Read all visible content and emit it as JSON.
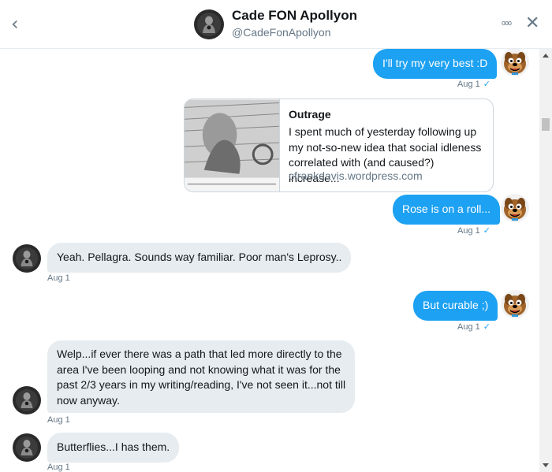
{
  "header": {
    "name": "Cade FON Apollyon",
    "handle": "@CadeFonApollyon",
    "back_icon": "chevron-left-icon",
    "more_icon": "more-dots-icon",
    "more_glyph": "ooo",
    "close_icon": "close-icon"
  },
  "colors": {
    "accent": "#1da1f2",
    "received_bubble": "#e6ecf0",
    "muted_text": "#657786"
  },
  "messages": [
    {
      "sender": "me",
      "text": "I'll try my very best :D",
      "time": "Aug 1"
    },
    {
      "sender": "me",
      "type": "link-card",
      "card": {
        "title": "Outrage",
        "description": "I spent much of yesterday following up my not-so-new idea that social idleness correlated with (and caused?) increase...",
        "url": "cfrankdavis.wordpress.com"
      }
    },
    {
      "sender": "me",
      "text": "Rose is on a roll...",
      "time": "Aug 1"
    },
    {
      "sender": "them",
      "text": "Yeah. Pellagra. Sounds way familiar. Poor man's Leprosy..",
      "time": "Aug 1"
    },
    {
      "sender": "me",
      "text": "But curable ;)",
      "time": "Aug 1"
    },
    {
      "sender": "them",
      "lines": [
        "Welp...if ever there was a path that led more directly to the",
        "area I've been looping and not knowing what it was for the",
        "past 2/3 years in my writing/reading, I've not seen it...not till",
        "now anyway."
      ],
      "time": "Aug 1"
    },
    {
      "sender": "them",
      "text": "Butterflies...I has them.",
      "time": "Aug 1"
    }
  ],
  "read_check": "✓"
}
